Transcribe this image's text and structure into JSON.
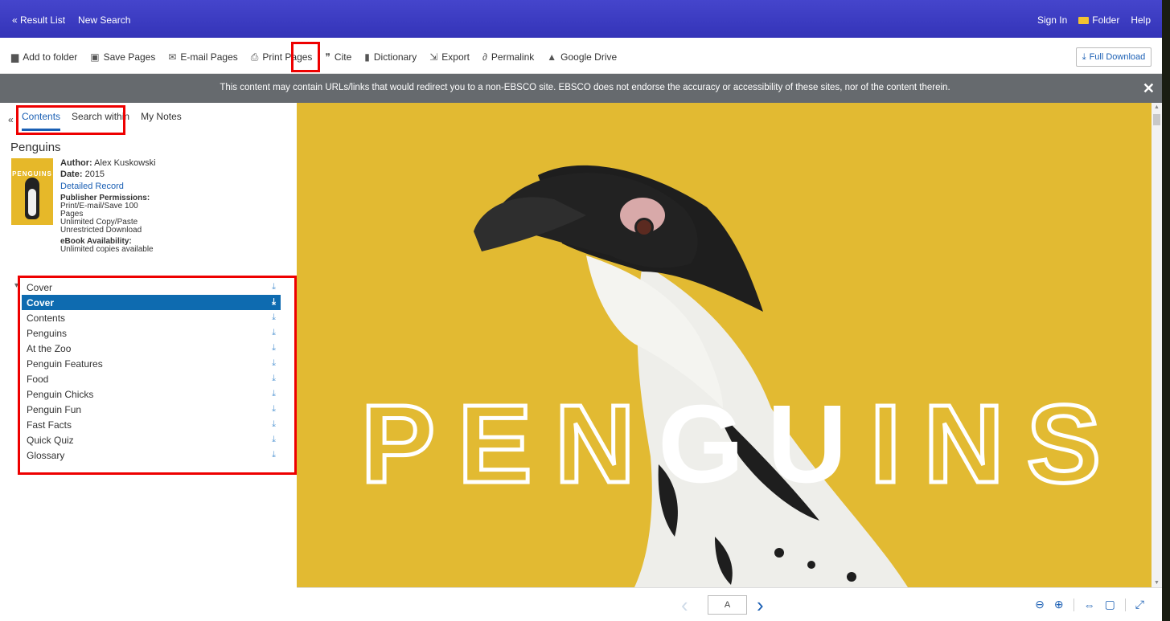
{
  "topbar": {
    "result_list": "« Result List",
    "new_search": "New Search",
    "sign_in": "Sign In",
    "folder": "Folder",
    "help": "Help"
  },
  "toolbar": {
    "add_to_folder": "Add to folder",
    "save_pages": "Save Pages",
    "email_pages": "E-mail Pages",
    "print_pages": "Print Pages",
    "cite": "Cite",
    "dictionary": "Dictionary",
    "export": "Export",
    "permalink": "Permalink",
    "google_drive": "Google Drive",
    "full_download": "Full Download"
  },
  "banner": {
    "message": "This content may contain URLs/links that would redirect you to a non-EBSCO site. EBSCO does not endorse the accuracy or accessibility of these sites, nor of the content therein.",
    "close": "✕"
  },
  "sidebar": {
    "collapse": "«",
    "tabs": [
      "Contents",
      "Search within",
      "My Notes"
    ],
    "book_title": "Penguins",
    "cover_text": "PENGUINS",
    "author_label": "Author:",
    "author_value": "Alex Kuskowski",
    "date_label": "Date:",
    "date_value": "2015",
    "detailed_record": "Detailed Record",
    "permissions_label": "Publisher Permissions:",
    "permissions_lines": [
      "Print/E-mail/Save 100 Pages",
      "Unlimited Copy/Paste",
      "Unrestricted Download"
    ],
    "availability_label": "eBook Availability:",
    "availability_value": "Unlimited copies available",
    "toc": [
      "Cover",
      "Cover",
      "Contents",
      "Penguins",
      "At the Zoo",
      "Penguin Features",
      "Food",
      "Penguin Chicks",
      "Penguin Fun",
      "Fast Facts",
      "Quick Quiz",
      "Glossary"
    ],
    "toc_selected_index": 1
  },
  "viewer": {
    "page_heading": [
      "P",
      "E",
      "N",
      "G",
      "U",
      "I",
      "N",
      "S"
    ]
  },
  "bottombar": {
    "page_value": "A"
  }
}
